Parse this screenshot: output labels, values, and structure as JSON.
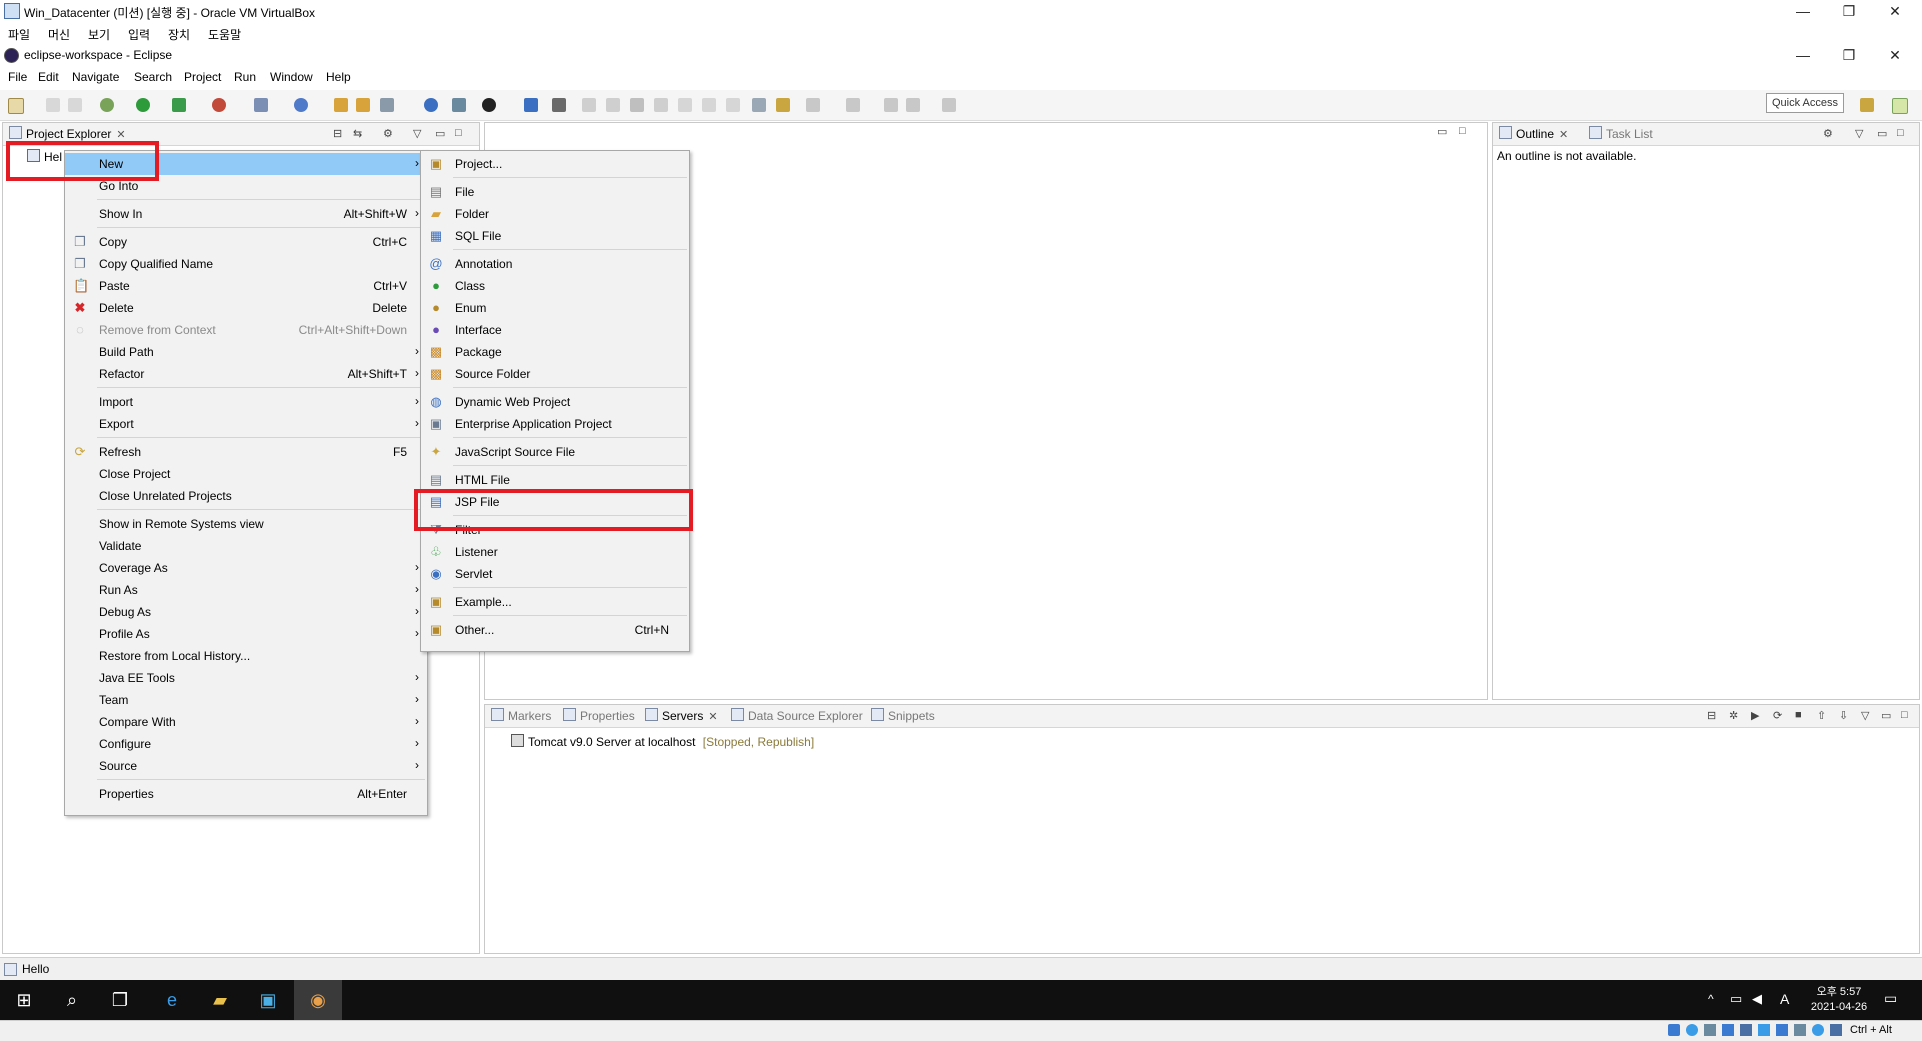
{
  "vbox": {
    "title": "Win_Datacenter (미션) [실행 중] - Oracle VM VirtualBox",
    "menu": [
      "파일",
      "머신",
      "보기",
      "입력",
      "장치",
      "도움말"
    ],
    "win_controls": [
      "—",
      "❐",
      "✕"
    ]
  },
  "eclipse": {
    "title": "eclipse-workspace - Eclipse",
    "menu": [
      "File",
      "Edit",
      "Navigate",
      "Search",
      "Project",
      "Run",
      "Window",
      "Help"
    ],
    "quick_access": "Quick Access"
  },
  "project_explorer": {
    "tab_label": "Project Explorer",
    "tree_item": "Hel"
  },
  "outline": {
    "tab_label": "Outline",
    "tab2_label": "Task List",
    "message": "An outline is not available."
  },
  "bottom_panel": {
    "tabs": [
      "Markers",
      "Properties",
      "Servers",
      "Data Source Explorer",
      "Snippets"
    ],
    "server_name": "Tomcat v9.0 Server at localhost",
    "server_status": "[Stopped, Republish]"
  },
  "context_menu": {
    "items": [
      {
        "label": "New",
        "accel": "",
        "sub": true
      },
      {
        "label": "Go Into",
        "accel": "",
        "sub": false
      },
      {
        "label": "Show In",
        "accel": "Alt+Shift+W",
        "sub": true
      },
      {
        "label": "Copy",
        "accel": "Ctrl+C",
        "sub": false
      },
      {
        "label": "Copy Qualified Name",
        "accel": "",
        "sub": false
      },
      {
        "label": "Paste",
        "accel": "Ctrl+V",
        "sub": false
      },
      {
        "label": "Delete",
        "accel": "Delete",
        "sub": false
      },
      {
        "label": "Remove from Context",
        "accel": "Ctrl+Alt+Shift+Down",
        "sub": false
      },
      {
        "label": "Build Path",
        "accel": "",
        "sub": true
      },
      {
        "label": "Refactor",
        "accel": "Alt+Shift+T",
        "sub": true
      },
      {
        "label": "Import",
        "accel": "",
        "sub": true
      },
      {
        "label": "Export",
        "accel": "",
        "sub": true
      },
      {
        "label": "Refresh",
        "accel": "F5",
        "sub": false
      },
      {
        "label": "Close Project",
        "accel": "",
        "sub": false
      },
      {
        "label": "Close Unrelated Projects",
        "accel": "",
        "sub": false
      },
      {
        "label": "Show in Remote Systems view",
        "accel": "",
        "sub": false
      },
      {
        "label": "Validate",
        "accel": "",
        "sub": false
      },
      {
        "label": "Coverage As",
        "accel": "",
        "sub": true
      },
      {
        "label": "Run As",
        "accel": "",
        "sub": true
      },
      {
        "label": "Debug As",
        "accel": "",
        "sub": true
      },
      {
        "label": "Profile As",
        "accel": "",
        "sub": true
      },
      {
        "label": "Restore from Local History...",
        "accel": "",
        "sub": false
      },
      {
        "label": "Java EE Tools",
        "accel": "",
        "sub": true
      },
      {
        "label": "Team",
        "accel": "",
        "sub": true
      },
      {
        "label": "Compare With",
        "accel": "",
        "sub": true
      },
      {
        "label": "Configure",
        "accel": "",
        "sub": true
      },
      {
        "label": "Source",
        "accel": "",
        "sub": true
      },
      {
        "label": "Properties",
        "accel": "Alt+Enter",
        "sub": false
      }
    ]
  },
  "new_submenu": {
    "items": [
      {
        "label": "Project...",
        "accel": ""
      },
      {
        "label": "File",
        "accel": ""
      },
      {
        "label": "Folder",
        "accel": ""
      },
      {
        "label": "SQL File",
        "accel": ""
      },
      {
        "label": "Annotation",
        "accel": ""
      },
      {
        "label": "Class",
        "accel": ""
      },
      {
        "label": "Enum",
        "accel": ""
      },
      {
        "label": "Interface",
        "accel": ""
      },
      {
        "label": "Package",
        "accel": ""
      },
      {
        "label": "Source Folder",
        "accel": ""
      },
      {
        "label": "Dynamic Web Project",
        "accel": ""
      },
      {
        "label": "Enterprise Application Project",
        "accel": ""
      },
      {
        "label": "JavaScript Source File",
        "accel": ""
      },
      {
        "label": "HTML File",
        "accel": ""
      },
      {
        "label": "JSP File",
        "accel": ""
      },
      {
        "label": "Filter",
        "accel": ""
      },
      {
        "label": "Listener",
        "accel": ""
      },
      {
        "label": "Servlet",
        "accel": ""
      },
      {
        "label": "Example...",
        "accel": ""
      },
      {
        "label": "Other...",
        "accel": "Ctrl+N"
      }
    ]
  },
  "status_bar": {
    "text": "Hello"
  },
  "taskbar": {
    "time": "오후 5:57",
    "date": "2021-04-26",
    "ime": "A",
    "host_key": "Ctrl + Alt"
  },
  "colors": {
    "highlight": "#91c9f7",
    "annotation_red": "#e51b24",
    "status_text": "#8b7a3a"
  }
}
